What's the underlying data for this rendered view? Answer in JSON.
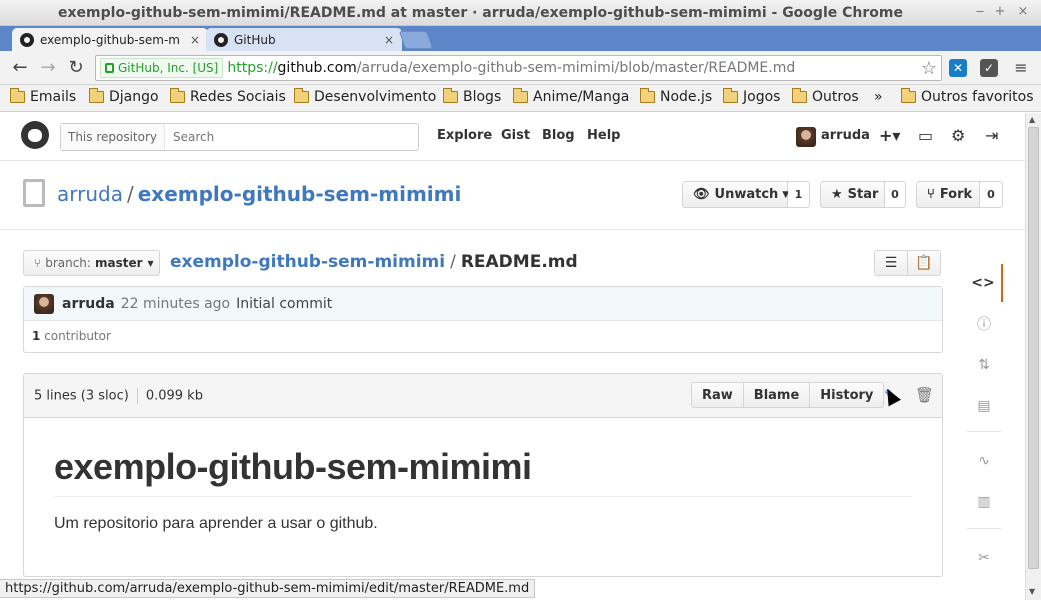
{
  "window": {
    "title": "exemplo-github-sem-mimimi/README.md at master · arruda/exemplo-github-sem-mimimi - Google Chrome",
    "minimize": "‒",
    "maximize": "+",
    "close": "×"
  },
  "tabs": [
    {
      "label": "exemplo-github-sem-m",
      "close": "×"
    },
    {
      "label": "GitHub",
      "close": "×"
    }
  ],
  "toolbar": {
    "ev_label": "GitHub, Inc. [US]",
    "url_scheme": "https://",
    "url_host": "github.com",
    "url_path": "/arruda/exemplo-github-sem-mimimi/blob/master/README.md"
  },
  "bookmarks": {
    "items": [
      "Emails",
      "Django",
      "Redes Sociais",
      "Desenvolvimento",
      "Blogs",
      "Anime/Manga",
      "Node.js",
      "Jogos",
      "Outros"
    ],
    "overflow": "»",
    "other": "Outros favoritos"
  },
  "header": {
    "search_scope": "This repository",
    "search_placeholder": "Search",
    "nav": [
      "Explore",
      "Gist",
      "Blog",
      "Help"
    ],
    "username": "arruda"
  },
  "repo": {
    "owner": "arruda",
    "separator": "/",
    "name": "exemplo-github-sem-mimimi",
    "unwatch_label": "Unwatch",
    "watch_count": "1",
    "star_label": "Star",
    "star_count": "0",
    "fork_label": "Fork",
    "fork_count": "0"
  },
  "file_nav": {
    "branch_prefix": "branch:",
    "branch": "master",
    "crumb_repo": "exemplo-github-sem-mimimi",
    "crumb_sep": "/",
    "crumb_file": "README.md"
  },
  "commit": {
    "author": "arruda",
    "time": "22 minutes ago",
    "message": "Initial commit",
    "contributor_count": "1",
    "contributor_label": "contributor"
  },
  "file": {
    "lines": "5 lines (3 sloc)",
    "size": "0.099 kb",
    "buttons": [
      "Raw",
      "Blame",
      "History"
    ]
  },
  "readme": {
    "heading": "exemplo-github-sem-mimimi",
    "paragraph": "Um repositorio para aprender a usar o github."
  },
  "status_bar": "https://github.com/arruda/exemplo-github-sem-mimimi/edit/master/README.md"
}
